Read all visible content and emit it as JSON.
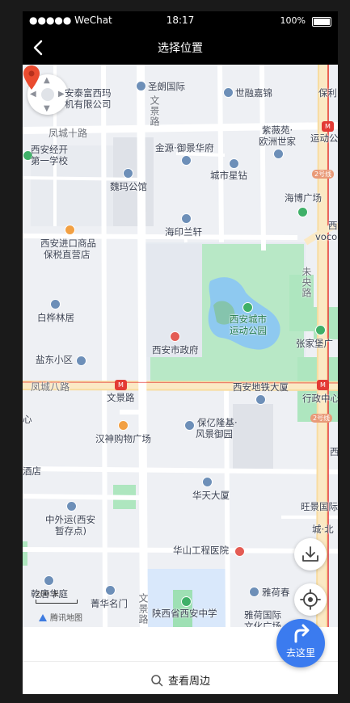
{
  "status_bar": {
    "carrier": "●●●●● WeChat",
    "time": "18:17",
    "battery": "100%"
  },
  "nav": {
    "title": "选择位置",
    "back_icon": "chevron-left-icon"
  },
  "map": {
    "labels": {
      "poi_1": "圣朗国际",
      "poi_2": "世融嘉锦",
      "poi_3": "保利",
      "poi_4a": "安泰富西玛",
      "poi_4b": "机有限公司",
      "road_wenjing_top": "文景路",
      "road_fengcheng10": "凤城十路",
      "poi_zixuan_a": "紫薇苑·",
      "poi_zixuan_b": "欧洲世家",
      "poi_yundong": "运动公",
      "poi_xiankaifa_a": "西安经开",
      "poi_xiankaifa_b": "第一学校",
      "poi_jinyuan": "金源·御景华府",
      "poi_weijing": "魏玛公馆",
      "poi_chengshi": "城市星钻",
      "poi_haibo": "海博广场",
      "poi_haiyin": "海印兰轩",
      "poi_xi": "西",
      "poi_voco": "voco",
      "poi_jinkou_a": "西安进口商品",
      "poi_jinkou_b": "保税直营店",
      "road_weiyang": "未央路",
      "poi_baihua": "白桦林居",
      "poi_park_a": "西安城市",
      "poi_park_b": "运动公园",
      "poi_zhangjiabao": "张家堡广",
      "poi_yandong": "盐东小区",
      "poi_gov": "西安市政府",
      "road_fengcheng8": "凤城八路",
      "poi_wenjinglu_station": "文景路",
      "poi_metro_ditie": "西安地铁大厦",
      "poi_xingzheng": "行政中心",
      "poi_xin": "心",
      "poi_hanshen": "汉神购物广场",
      "poi_baoyi_a": "保亿隆基·",
      "poi_baoyi_b": "风景御园",
      "poi_xi2": "西",
      "poi_dian": "酒店",
      "poi_huatian": "华天大厦",
      "poi_wangjing": "旺景国际",
      "poi_zhongwaiyun_a": "中外运(西安",
      "poi_zhongwaiyun_b": "暂存点)",
      "poi_cheng": "城·北",
      "poi_huashan": "华山工程医院",
      "poi_yahe": "雅荷春",
      "poi_qianlong": "乾唐华庭",
      "poi_qingnian": "菁华名门",
      "road_wenjing_bottom": "文景路",
      "poi_shaanxi": "陕西省西安中学",
      "poi_yaheguoji_a": "雅荷国际",
      "poi_yaheguoji_b": "文化广场",
      "line_tag_1": "2号线",
      "line_tag_2": "2号线"
    },
    "scale_label": "200 米",
    "logo": "腾讯地图",
    "accent": "#3b7bef",
    "pin_color": "#ea4b2f"
  },
  "buttons": {
    "navigate_label": "去这里",
    "download_icon": "download-icon",
    "locate_icon": "locate-icon"
  },
  "panel": {
    "nearby_label": "查看周边"
  }
}
